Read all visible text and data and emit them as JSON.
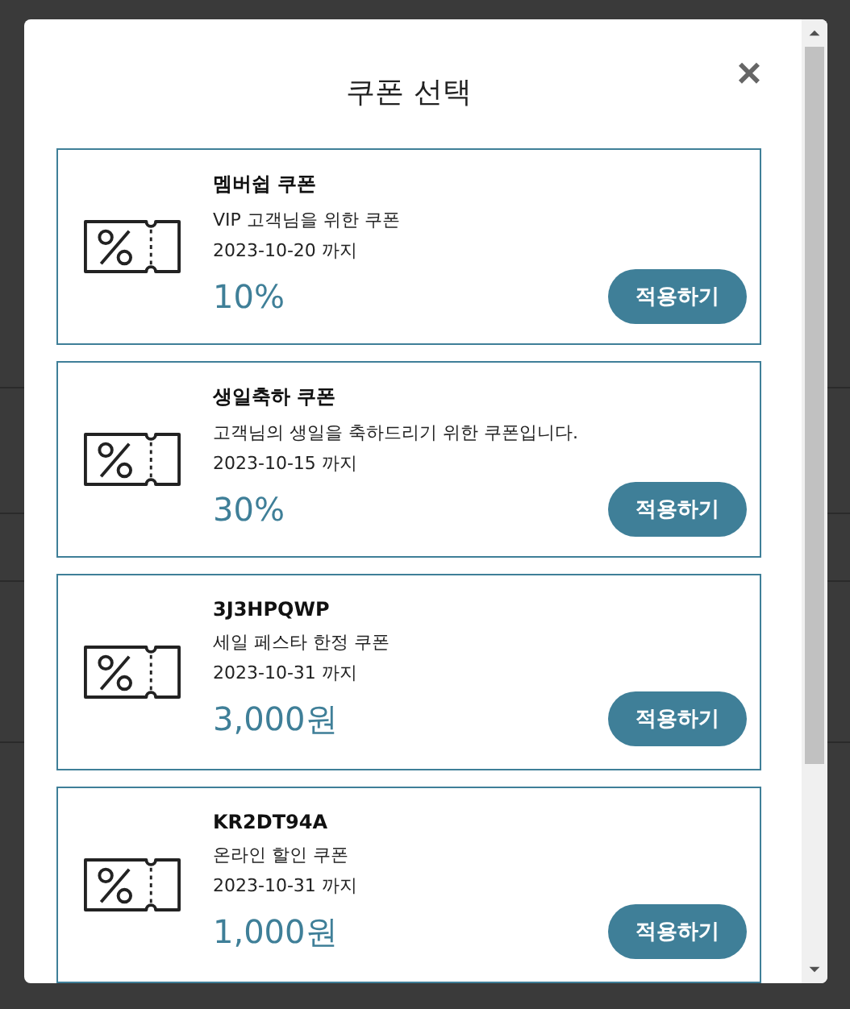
{
  "modal": {
    "title": "쿠폰 선택",
    "close": "×",
    "coupons": [
      {
        "name": "멤버쉽 쿠폰",
        "description": "VIP 고객님을 위한 쿠폰",
        "expiry": "2023-10-20 까지",
        "discount": "10%",
        "button": "적용하기"
      },
      {
        "name": "생일축하 쿠폰",
        "description": "고객님의 생일을 축하드리기 위한 쿠폰입니다.",
        "expiry": "2023-10-15 까지",
        "discount": "30%",
        "button": "적용하기"
      },
      {
        "name": "3J3HPQWP",
        "description": "세일 페스타 한정 쿠폰",
        "expiry": "2023-10-31 까지",
        "discount": "3,000원",
        "button": "적용하기"
      },
      {
        "name": "KR2DT94A",
        "description": "온라인 할인 쿠폰",
        "expiry": "2023-10-31 까지",
        "discount": "1,000원",
        "button": "적용하기"
      }
    ]
  }
}
